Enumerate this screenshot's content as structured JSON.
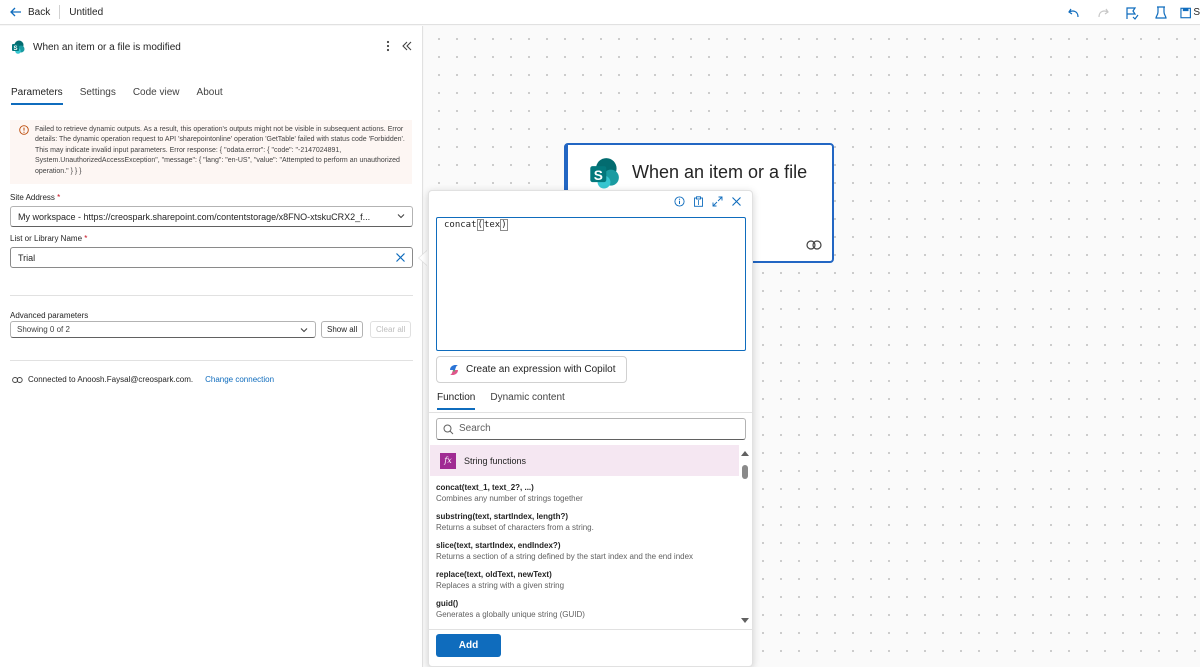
{
  "topbar": {
    "back_label": "Back",
    "title": "Untitled",
    "cut_label": "S"
  },
  "panel": {
    "title": "When an item or a file is modified",
    "tabs": [
      {
        "label": "Parameters",
        "active": true
      },
      {
        "label": "Settings",
        "active": false
      },
      {
        "label": "Code view",
        "active": false
      },
      {
        "label": "About",
        "active": false
      }
    ],
    "warning": "Failed to retrieve dynamic outputs. As a result, this operation's outputs might not be visible in subsequent actions. Error details: The dynamic operation request to API 'sharepointonline' operation 'GetTable' failed with status code 'Forbidden'. This may indicate invalid input parameters. Error response: { \"odata.error\": { \"code\": \"-2147024891, System.UnauthorizedAccessException\", \"message\": { \"lang\": \"en-US\", \"value\": \"Attempted to perform an unauthorized operation.\" } } }",
    "site_address": {
      "label": "Site Address",
      "required_mark": "*",
      "value": "My workspace - https://creospark.sharepoint.com/contentstorage/x8FNO-xtskuCRX2_f..."
    },
    "list_name": {
      "label": "List or Library Name",
      "required_mark": "*",
      "value": "Trial"
    },
    "advanced": {
      "label": "Advanced parameters",
      "select_value": "Showing 0 of 2",
      "show_all": "Show all",
      "clear_all": "Clear all"
    },
    "connection": {
      "text": "Connected to Anoosh.Faysal@creospark.com.",
      "change_link": "Change connection"
    }
  },
  "canvas": {
    "node_title": "When an item or a file"
  },
  "popup": {
    "expression_prefix": "concat",
    "expression_paren_open": "(",
    "expression_arg": "tex",
    "expression_paren_close": ")",
    "copilot_label": "Create an expression with Copilot",
    "tabs": [
      {
        "label": "Function",
        "active": true
      },
      {
        "label": "Dynamic content",
        "active": false
      }
    ],
    "search_placeholder": "Search",
    "category": "String functions",
    "functions": [
      {
        "name": "concat(text_1, text_2?, ...)",
        "desc": "Combines any number of strings together"
      },
      {
        "name": "substring(text, startIndex, length?)",
        "desc": "Returns a subset of characters from a string."
      },
      {
        "name": "slice(text, startIndex, endIndex?)",
        "desc": "Returns a section of a string defined by the start index and the end index"
      },
      {
        "name": "replace(text, oldText, newText)",
        "desc": "Replaces a string with a given string"
      },
      {
        "name": "guid()",
        "desc": "Generates a globally unique string (GUID)"
      }
    ],
    "add_label": "Add"
  },
  "colors": {
    "accent": "#0f6cbd",
    "node_border": "#2266c3",
    "category_bg": "#f5e7f2",
    "fx_badge": "#a02b93",
    "warning_bg": "#fdf6f3",
    "sharepoint_teal": "#038387"
  }
}
